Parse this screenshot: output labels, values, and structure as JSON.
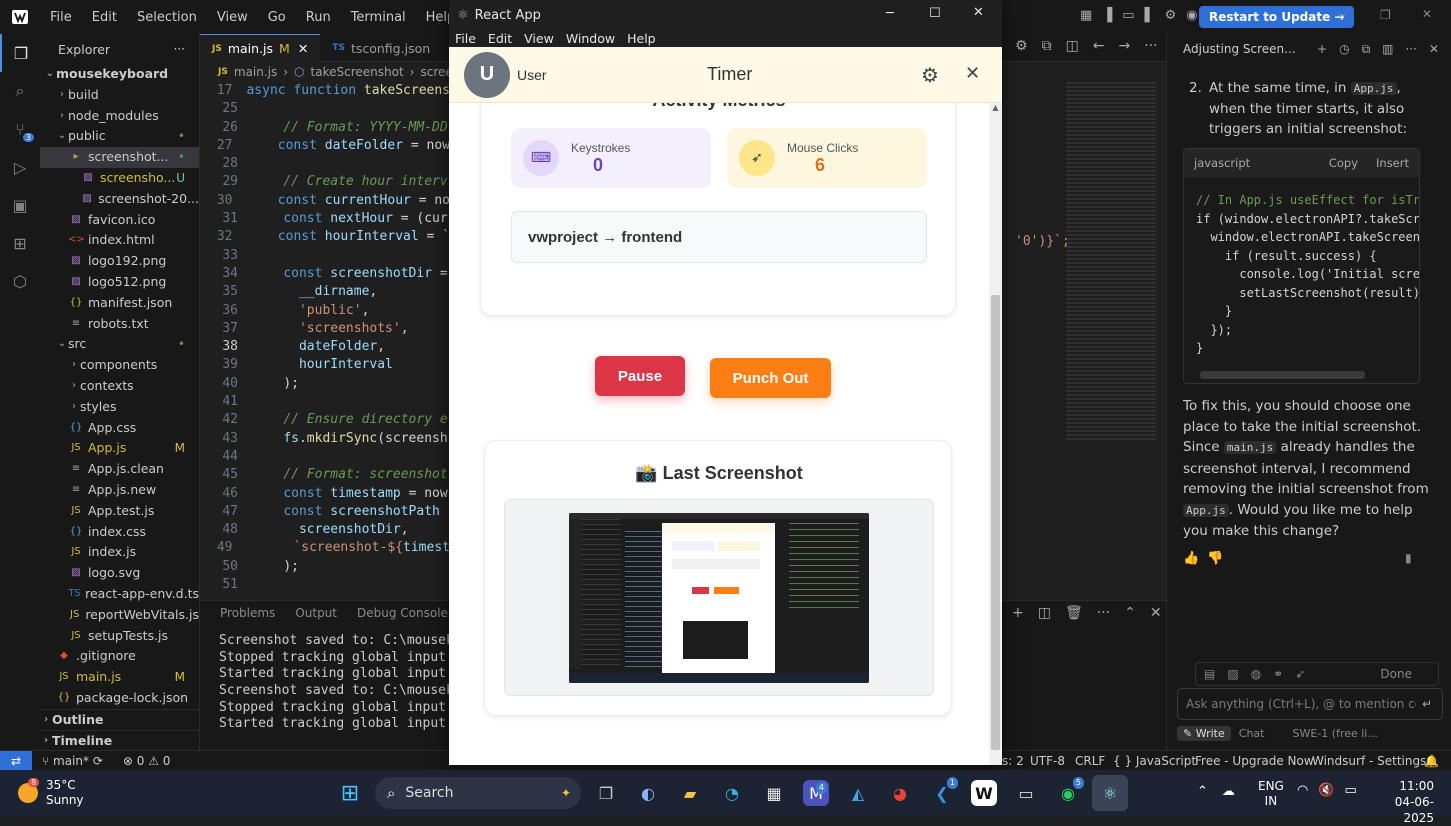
{
  "ide": {
    "menu": [
      "File",
      "Edit",
      "Selection",
      "View",
      "Go",
      "Run",
      "Terminal",
      "Help"
    ],
    "restart_button": "Restart to Update →",
    "explorer": {
      "title": "Explorer",
      "root": "mousekeyboard",
      "items": [
        {
          "label": "build",
          "icon": "chevron",
          "indent": 1,
          "badge": ""
        },
        {
          "label": "node_modules",
          "icon": "chevron",
          "indent": 1,
          "badge": ""
        },
        {
          "label": "public",
          "icon": "chevron-open",
          "indent": 1,
          "badge": "•"
        },
        {
          "label": "screenshot...",
          "icon": "folder",
          "indent": 2,
          "badge": "•"
        },
        {
          "label": "screensho...",
          "icon": "image",
          "indent": 3,
          "badge": "U"
        },
        {
          "label": "screenshot-20...",
          "icon": "image",
          "indent": 3,
          "badge": ""
        },
        {
          "label": "favicon.ico",
          "icon": "image",
          "indent": 2,
          "badge": ""
        },
        {
          "label": "index.html",
          "icon": "html",
          "indent": 2,
          "badge": ""
        },
        {
          "label": "logo192.png",
          "icon": "image",
          "indent": 2,
          "badge": ""
        },
        {
          "label": "logo512.png",
          "icon": "image",
          "indent": 2,
          "badge": ""
        },
        {
          "label": "manifest.json",
          "icon": "json",
          "indent": 2,
          "badge": ""
        },
        {
          "label": "robots.txt",
          "icon": "text",
          "indent": 2,
          "badge": ""
        },
        {
          "label": "src",
          "icon": "chevron-open",
          "indent": 1,
          "badge": "•"
        },
        {
          "label": "components",
          "icon": "chevron",
          "indent": 2,
          "badge": ""
        },
        {
          "label": "contexts",
          "icon": "chevron",
          "indent": 2,
          "badge": ""
        },
        {
          "label": "styles",
          "icon": "chevron",
          "indent": 2,
          "badge": ""
        },
        {
          "label": "App.css",
          "icon": "css",
          "indent": 2,
          "badge": ""
        },
        {
          "label": "App.js",
          "icon": "js",
          "indent": 2,
          "badge": "M"
        },
        {
          "label": "App.js.clean",
          "icon": "text",
          "indent": 2,
          "badge": ""
        },
        {
          "label": "App.js.new",
          "icon": "text",
          "indent": 2,
          "badge": ""
        },
        {
          "label": "App.test.js",
          "icon": "js",
          "indent": 2,
          "badge": ""
        },
        {
          "label": "index.css",
          "icon": "css",
          "indent": 2,
          "badge": ""
        },
        {
          "label": "index.js",
          "icon": "js",
          "indent": 2,
          "badge": ""
        },
        {
          "label": "logo.svg",
          "icon": "image",
          "indent": 2,
          "badge": ""
        },
        {
          "label": "react-app-env.d.ts",
          "icon": "ts",
          "indent": 2,
          "badge": ""
        },
        {
          "label": "reportWebVitals.js",
          "icon": "js",
          "indent": 2,
          "badge": ""
        },
        {
          "label": "setupTests.js",
          "icon": "js",
          "indent": 2,
          "badge": ""
        },
        {
          "label": ".gitignore",
          "icon": "git",
          "indent": 1,
          "badge": ""
        },
        {
          "label": "main.js",
          "icon": "js",
          "indent": 1,
          "badge": "M"
        },
        {
          "label": "package-lock.json",
          "icon": "json",
          "indent": 1,
          "badge": ""
        }
      ],
      "outline": "Outline",
      "timeline": "Timeline"
    },
    "tabs": [
      {
        "label": "main.js",
        "flag": "M",
        "active": true,
        "prefix": "JS"
      },
      {
        "label": "tsconfig.json",
        "flag": "",
        "active": false,
        "prefix": "TS"
      }
    ],
    "breadcrumb": [
      "main.js",
      "takeScreenshot",
      "scree"
    ],
    "code_lines": [
      {
        "n": "17",
        "html": "<span class='kw'>async</span> <span class='kw'>function</span> <span class='fn'>takeScreens</span>"
      },
      {
        "n": "25",
        "html": ""
      },
      {
        "n": "26",
        "html": "    <span class='cm'>// Format: YYYY-MM-DD</span>"
      },
      {
        "n": "27",
        "html": "    <span class='kw'>const</span> <span class='var'>dateFolder</span> <span class='pl'>= now</span>"
      },
      {
        "n": "28",
        "html": ""
      },
      {
        "n": "29",
        "html": "    <span class='cm'>// Create hour interv</span>"
      },
      {
        "n": "30",
        "html": "    <span class='kw'>const</span> <span class='var'>currentHour</span> <span class='pl'>= no</span>"
      },
      {
        "n": "31",
        "html": "    <span class='kw'>const</span> <span class='var'>nextHour</span> <span class='pl'>= (cur</span>"
      },
      {
        "n": "32",
        "html": "    <span class='kw'>const</span> <span class='var'>hourInterval</span> <span class='pl'>= `</span>"
      },
      {
        "n": "33",
        "html": ""
      },
      {
        "n": "34",
        "html": "    <span class='kw'>const</span> <span class='var'>screenshotDir</span> <span class='pl'>=</span>"
      },
      {
        "n": "35",
        "html": "      <span class='var'>__dirname</span><span class='pl'>,</span>"
      },
      {
        "n": "36",
        "html": "      <span class='str'>'public'</span><span class='pl'>,</span>"
      },
      {
        "n": "37",
        "html": "      <span class='str'>'screenshots'</span><span class='pl'>,</span>"
      },
      {
        "n": "38",
        "html": "      <span class='var'>dateFolder</span><span class='pl'>,</span>"
      },
      {
        "n": "39",
        "html": "      <span class='var'>hourInterval</span>"
      },
      {
        "n": "40",
        "html": "    <span class='pl'>);</span>"
      },
      {
        "n": "41",
        "html": ""
      },
      {
        "n": "42",
        "html": "    <span class='cm'>// Ensure directory e</span>"
      },
      {
        "n": "43",
        "html": "    <span class='var'>fs</span><span class='pl'>.</span><span class='fn'>mkdirSync</span><span class='pl'>(screensh</span>"
      },
      {
        "n": "44",
        "html": ""
      },
      {
        "n": "45",
        "html": "    <span class='cm'>// Format: screenshot</span>"
      },
      {
        "n": "46",
        "html": "    <span class='kw'>const</span> <span class='var'>timestamp</span> <span class='pl'>= now</span>"
      },
      {
        "n": "47",
        "html": "    <span class='kw'>const</span> <span class='var'>screenshotPath</span>"
      },
      {
        "n": "48",
        "html": "      <span class='var'>screenshotDir</span><span class='pl'>,</span>"
      },
      {
        "n": "49",
        "html": "      <span class='str'>`screenshot-${</span><span class='var'>timest</span>"
      },
      {
        "n": "50",
        "html": "    <span class='pl'>);</span>"
      },
      {
        "n": "51",
        "html": ""
      }
    ],
    "code_tail_text": "'0')}`;",
    "panel_tabs": [
      "Problems",
      "Output",
      "Debug Console"
    ],
    "terminal_lines": [
      "Screenshot saved to: C:\\mousekeybo",
      "Stopped tracking global input even",
      "Started tracking global input even",
      "Screenshot saved to: C:\\mousekeybo",
      "Stopped tracking global input even",
      "Started tracking global input even"
    ],
    "chat": {
      "title": "Adjusting Screen...",
      "step_text_1": "At the same time, in",
      "step_code": "App.js",
      "step_text_2": ", when the timer starts, it also triggers an initial screenshot:",
      "code_lang": "javascript",
      "copy_label": "Copy",
      "insert_label": "Insert",
      "code_lines": [
        "// In App.js useEffect for isTrac",
        "if (window.electronAPI?.takeScree",
        "  window.electronAPI.takeScreensh",
        "    if (result.success) {",
        "      console.log('Initial screen",
        "      setLastScreenshot(result);",
        "    }",
        "  });",
        "}"
      ],
      "para_1": "To fix this, you should choose one place to take the initial screenshot. Since",
      "para_code_1": "main.js",
      "para_2": "already handles the screenshot interval, I recommend removing the initial screenshot from",
      "para_code_2": "App.js",
      "para_3": ". Would you like me to help you make this change?",
      "done_label": "Done",
      "input_placeholder": "Ask anything (Ctrl+L), @ to mention code l",
      "write_label": "Write",
      "chat_label": "Chat",
      "model_label": "SWE-1 (free li..."
    },
    "status": {
      "branch": "main*",
      "problems": "⊗ 0 ⚠ 0",
      "spaces": "s: 2",
      "encoding": "UTF-8",
      "eol": "CRLF",
      "language": "{ } JavaScript",
      "plan": "Free - Upgrade Now",
      "settings": "Windsurf - Settings"
    }
  },
  "app": {
    "window_title": "React App",
    "menu": [
      "File",
      "Edit",
      "View",
      "Window",
      "Help"
    ],
    "user_initial": "U",
    "user_name": "User",
    "header_title": "Timer",
    "section_title": "Activity Metrics",
    "keystrokes_label": "Keystrokes",
    "keystrokes_value": "0",
    "mouse_label": "Mouse Clicks",
    "mouse_value": "6",
    "project_path": "vwproject → frontend",
    "pause_label": "Pause",
    "punch_out_label": "Punch Out",
    "last_screenshot_title": "📸 Last Screenshot",
    "colors": {
      "pause": "#dc3545",
      "punch_out": "#fd7e14",
      "header_bg": "#fef9e7"
    }
  },
  "taskbar": {
    "weather_temp": "35°C",
    "weather_text": "Sunny",
    "weather_badge": "8",
    "search_label": "Search",
    "lang_1": "ENG",
    "lang_2": "IN",
    "time": "11:00",
    "date": "04-06-2025",
    "badges": {
      "teams": "4",
      "vscode": "1",
      "whatsapp": "5"
    }
  }
}
